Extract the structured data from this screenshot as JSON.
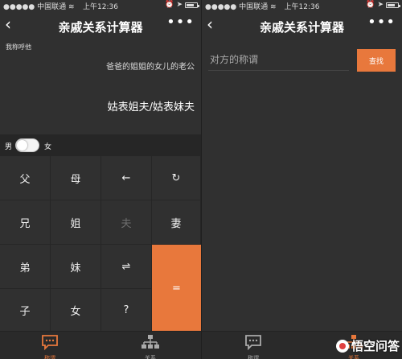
{
  "accent_color": "#e8783c",
  "status": {
    "carrier": "中国联通",
    "time": "上午12:36",
    "battery_level": 0.75
  },
  "left": {
    "nav": {
      "title": "亲戚关系计算器"
    },
    "calc": {
      "caption": "我称呼他",
      "expression": "爸爸的姐姐的女儿的老公",
      "result": "姑表姐夫/姑表妹夫"
    },
    "gender": {
      "male": "男",
      "female": "女"
    },
    "keypad": [
      {
        "label": "父",
        "name": "key-father"
      },
      {
        "label": "母",
        "name": "key-mother"
      },
      {
        "label": "←",
        "name": "key-backspace"
      },
      {
        "label": "↻",
        "name": "key-reset"
      },
      {
        "label": "兄",
        "name": "key-elder-brother"
      },
      {
        "label": "姐",
        "name": "key-elder-sister"
      },
      {
        "label": "夫",
        "name": "key-husband"
      },
      {
        "label": "妻",
        "name": "key-wife"
      },
      {
        "label": "弟",
        "name": "key-younger-brother"
      },
      {
        "label": "妹",
        "name": "key-younger-sister"
      },
      {
        "label": "⇌",
        "name": "key-swap"
      },
      {
        "label": "子",
        "name": "key-son"
      },
      {
        "label": "女",
        "name": "key-daughter"
      },
      {
        "label": "?",
        "name": "key-question"
      },
      {
        "label": "=",
        "name": "key-equals"
      }
    ],
    "tabs": {
      "title_tab": "称谓",
      "relation_tab": "关系"
    }
  },
  "right": {
    "nav": {
      "title": "亲戚关系计算器"
    },
    "search": {
      "placeholder": "对方的称谓",
      "button": "查找"
    },
    "tabs": {
      "title_tab": "称谓",
      "relation_tab": "关系"
    }
  },
  "watermark": {
    "text": "悟空问答"
  }
}
